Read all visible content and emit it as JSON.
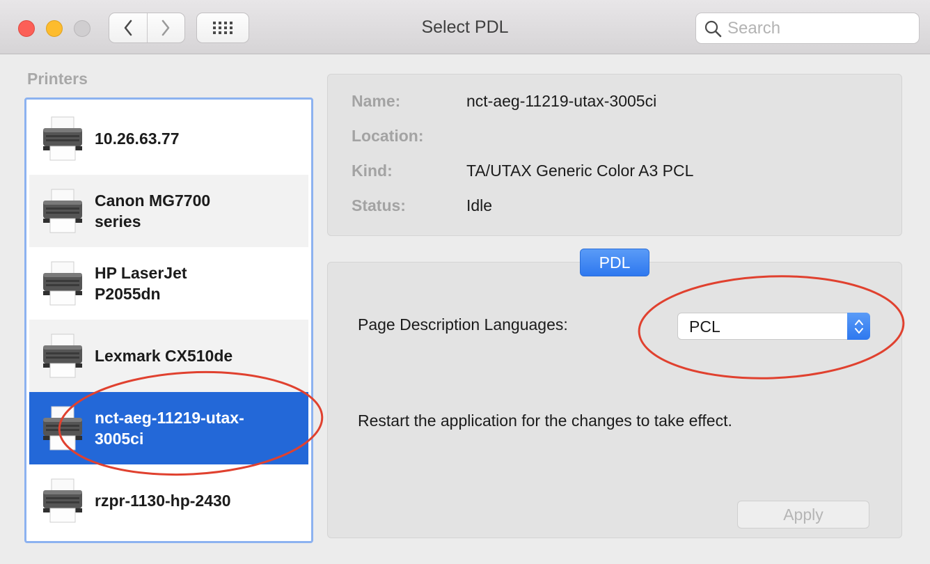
{
  "window": {
    "title": "Select PDL"
  },
  "toolbar": {
    "back_icon": "chevron-left-icon",
    "forward_icon": "chevron-right-icon",
    "grid_icon": "grid-icon"
  },
  "search": {
    "placeholder": "Search"
  },
  "sidebar": {
    "heading": "Printers",
    "printers": [
      {
        "label": "10.26.63.77",
        "selected": false
      },
      {
        "label": "Canon MG7700 series",
        "selected": false
      },
      {
        "label": "HP LaserJet P2055dn",
        "selected": false
      },
      {
        "label": "Lexmark CX510de",
        "selected": false
      },
      {
        "label": "nct-aeg-11219-utax-3005ci",
        "selected": true
      },
      {
        "label": "rzpr-1130-hp-2430",
        "selected": false
      }
    ]
  },
  "details": {
    "name_label": "Name:",
    "name_value": "nct-aeg-11219-utax-3005ci",
    "location_label": "Location:",
    "location_value": "",
    "kind_label": "Kind:",
    "kind_value": "TA/UTAX Generic Color A3 PCL",
    "status_label": "Status:",
    "status_value": "Idle"
  },
  "pdl": {
    "tab_label": "PDL",
    "field_label": "Page Description Languages:",
    "selected_value": "PCL",
    "note": "Restart the application for the changes to take effect.",
    "apply_label": "Apply"
  },
  "colors": {
    "selection": "#2368d8",
    "accent": "#2e78ef",
    "annotation": "#e0412f"
  }
}
